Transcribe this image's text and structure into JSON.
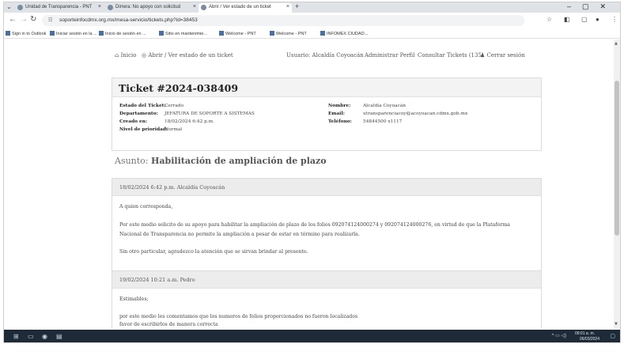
{
  "browser": {
    "tabs": [
      {
        "title": "Unidad de Transparencia - PNT",
        "active": false
      },
      {
        "title": "Dirrera: No apoyo con solicitud",
        "active": false
      },
      {
        "title": "Abrir / Ver estado de un ticket",
        "active": true
      }
    ],
    "url": "soporteinfocdmx.org.mx/mesa-servicio/tickets.php?id=38453",
    "bookmarks": [
      "Sign in to Outlook",
      "Iniciar sesión en la ...",
      "Inicio de sesión en ...",
      "Sitio en mantenimie...",
      "Welcome - PNT",
      "Welcome - PNT",
      "INFOMEX CIUDAD..."
    ]
  },
  "site_nav": {
    "home": "Inicio",
    "breadcrumb": "Abrir / Ver estado de un ticket",
    "user": "Usuario: Alcaldía Coyoacán",
    "admin": "Administrar Perfil",
    "consult": "Consultar Tickets (135)",
    "logout": "Cerrar sesión"
  },
  "ticket": {
    "title": "Ticket #2024-038409",
    "status_label": "Estado del Ticket:",
    "status": "Cerrado",
    "department_label": "Departamento:",
    "department": "JEFATURA DE SOPORTE A SISTEMAS",
    "created_label": "Creado en:",
    "created": "18/02/2024 6:42 p.m.",
    "priority_label": "Nivel de prioridad:",
    "priority": "Normal",
    "name_label": "Nombre:",
    "name": "Alcaldía Coyoacán",
    "email_label": "Email:",
    "email": "utransparenciacoy@acoyoacan.cdmx.gob.mx",
    "phone_label": "Teléfono:",
    "phone": "54844500 x1117"
  },
  "subject": {
    "label": "Asunto:",
    "text": "Habilitación de ampliación de plazo"
  },
  "messages": [
    {
      "header": "18/02/2024 6:42 p.m.  Alcaldía Coyoacán",
      "lines": [
        "A quien corresponda,",
        "Por este medio solicito de su apoyo para habilitar la ampliación de plazo de los folios 092074124000274 y 092074124000276, en virtud de que la Plataforma",
        "Nacional de Transparencia no permite la ampliación a pesar de estar en término para realizarla.",
        "Sin otro particular, agradezco la atención que se sirvan brindar al presente."
      ]
    },
    {
      "header": "19/02/2024 10:21 a.m.  Pedro",
      "lines": [
        "Estimables;",
        "por este medio les comentamos que los numeros de folios proporcionados no fueron localizados",
        "favor de escribirlos de manera correcta"
      ]
    }
  ],
  "taskbar": {
    "clock_time": "09:01 a. m.",
    "clock_date": "06/03/2024"
  }
}
